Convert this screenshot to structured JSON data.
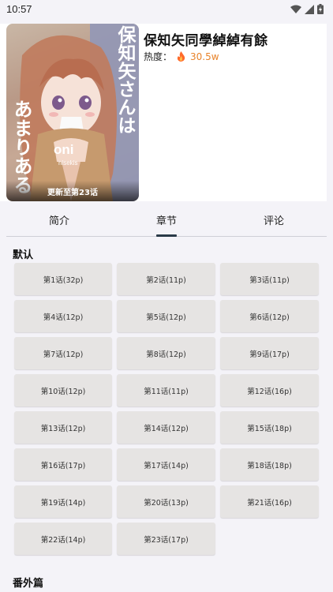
{
  "status_bar": {
    "time": "10:57"
  },
  "comic": {
    "title": "保知矢同學綽綽有餘",
    "heat_label": "热度：",
    "heat_value": "30.5w",
    "cover_caption": "更新至第23话",
    "cover_text": {
      "right": "保知矢さんは",
      "left": "あまりある",
      "logo": "oni",
      "logo_sub": "nisekis"
    }
  },
  "tabs": [
    {
      "label": "简介"
    },
    {
      "label": "章节"
    },
    {
      "label": "评论"
    }
  ],
  "sections": [
    {
      "title": "默认"
    },
    {
      "title": "番外篇"
    }
  ],
  "chapters": [
    "第1话(32p)",
    "第2话(11p)",
    "第3话(11p)",
    "第4话(12p)",
    "第5话(12p)",
    "第6话(12p)",
    "第7话(12p)",
    "第8话(12p)",
    "第9话(17p)",
    "第10话(12p)",
    "第11话(11p)",
    "第12话(16p)",
    "第13话(12p)",
    "第14话(12p)",
    "第15话(18p)",
    "第16话(17p)",
    "第17话(14p)",
    "第18话(18p)",
    "第19话(14p)",
    "第20话(13p)",
    "第21话(16p)",
    "第22话(14p)",
    "第23话(17p)"
  ],
  "colors": {
    "accent_heat": "#e8832a",
    "tab_indicator": "#2a3a48",
    "chapter_bg": "#e6e4e3"
  }
}
